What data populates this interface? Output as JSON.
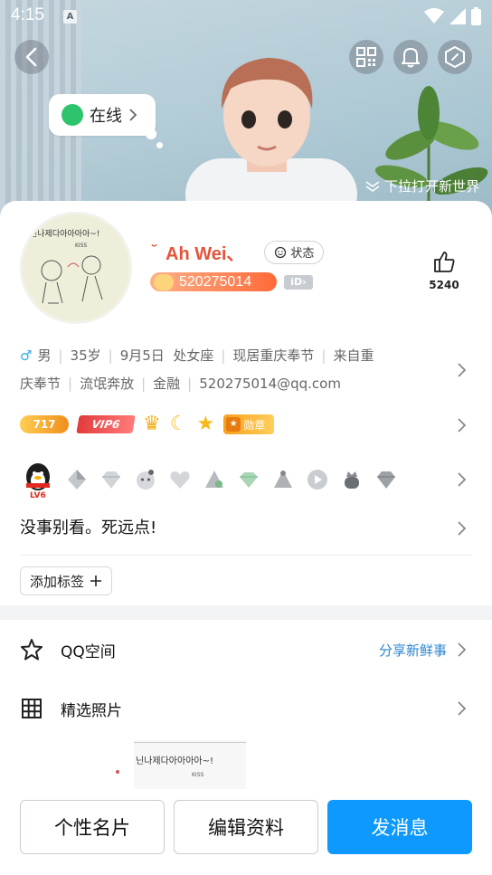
{
  "status_bar": {
    "time": "4:15",
    "app_icon": "A"
  },
  "header": {
    "online_status": "在线",
    "pull_hint": "下拉打开新世界"
  },
  "profile": {
    "name": "Ah Wei、",
    "status_button": "状态",
    "qq_number": "520275014",
    "id_tag": "iD",
    "likes": "5240",
    "info_line1": [
      "男",
      "35岁",
      "9月5日",
      "处女座",
      "现居重庆奉节",
      "来自重"
    ],
    "info_line2": [
      "庆奉节",
      "流氓奔放",
      "金融",
      "520275014@qq.com"
    ],
    "level_coin": "717",
    "vip_label": "VIP6",
    "medal_label": "勋章",
    "penguin_level": "LV6",
    "signature": "没事别看。死远点!",
    "add_tag_label": "添加标签"
  },
  "avatar_text": "닌나제다아아아아~!",
  "avatar_sub": "KISS",
  "list": {
    "qzone_label": "QQ空间",
    "qzone_action": "分享新鲜事",
    "photos_label": "精选照片"
  },
  "preview_text": "닌나제다아아아아~!",
  "preview_sub": "KISS",
  "bottom_buttons": {
    "card": "个性名片",
    "edit": "编辑资料",
    "message": "发消息"
  },
  "colors": {
    "name": "#e5533b",
    "primary_button": "#0d99ff",
    "link": "#2b84d0",
    "online": "#2ec46d"
  }
}
